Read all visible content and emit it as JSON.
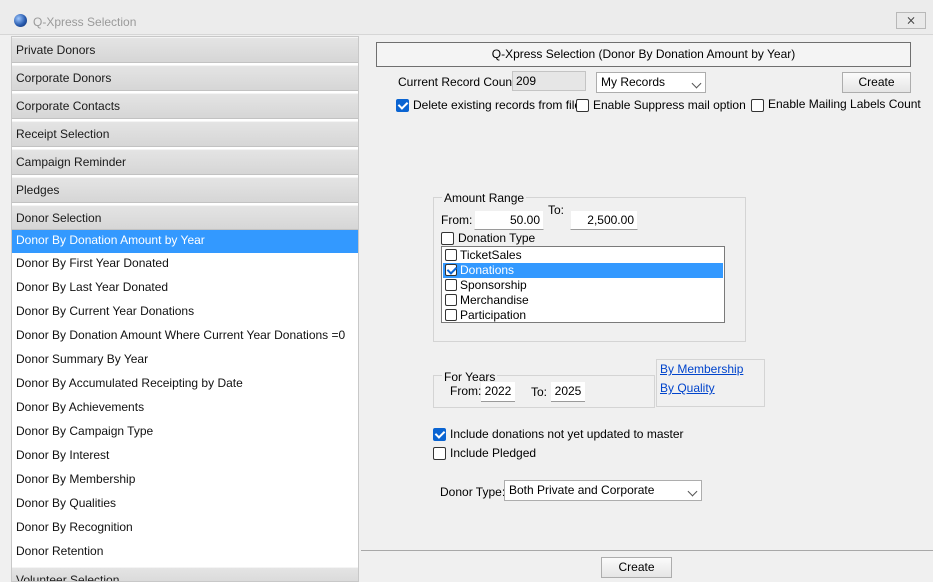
{
  "window": {
    "title": "Q-Xpress Selection",
    "close_glyph": "⨯"
  },
  "sidebar": {
    "headers": [
      "Private Donors",
      "Corporate Donors",
      "Corporate Contacts",
      "Receipt Selection",
      "Campaign Reminder",
      "Pledges",
      "Donor Selection"
    ],
    "items": [
      "Donor By Donation Amount by Year",
      "Donor By First Year Donated",
      "Donor By Last Year Donated",
      "Donor By Current Year Donations",
      "Donor By Donation Amount Where Current Year Donations =0",
      "Donor Summary By Year",
      "Donor By Accumulated Receipting by Date",
      "Donor By Achievements",
      "Donor By Campaign Type",
      "Donor By Interest",
      "Donor By Membership",
      "Donor By Qualities",
      "Donor By Recognition",
      "Donor Retention"
    ],
    "selected_item": "Donor By Donation Amount by Year",
    "footer_header": "Volunteer Selection"
  },
  "main": {
    "heading": "Q-Xpress Selection (Donor By Donation Amount by Year)",
    "record_count_label": "Current Record Count:",
    "record_count_value": "209",
    "records_select": "My Records",
    "create_top": "Create",
    "delete_existing": {
      "label": "Delete existing records from file",
      "checked": true
    },
    "enable_suppress": {
      "label": "Enable Suppress mail option",
      "checked": false
    },
    "enable_mailing": {
      "label": "Enable Mailing Labels Count",
      "checked": false
    },
    "amount_range": {
      "title": "Amount Range",
      "from_label": "From:",
      "from_value": "50.00",
      "to_label": "To:",
      "to_value": "2,500.00"
    },
    "donation_type": {
      "label": "Donation Type",
      "checked": false,
      "options": [
        {
          "label": "TicketSales",
          "checked": false
        },
        {
          "label": "Donations",
          "checked": true
        },
        {
          "label": "Sponsorship",
          "checked": false
        },
        {
          "label": "Merchandise",
          "checked": false
        },
        {
          "label": "Participation",
          "checked": false
        }
      ]
    },
    "for_years": {
      "title": "For Years",
      "from_label": "From:",
      "from_value": "2022",
      "to_label": "To:",
      "to_value": "2025"
    },
    "links": {
      "membership": "By Membership",
      "quality": "By Quality"
    },
    "include_not_updated": {
      "label": "Include donations not yet updated to master",
      "checked": true
    },
    "include_pledged": {
      "label": "Include Pledged",
      "checked": false
    },
    "donor_type_label": "Donor Type:",
    "donor_type_value": "Both Private and Corporate",
    "create_bottom": "Create"
  }
}
